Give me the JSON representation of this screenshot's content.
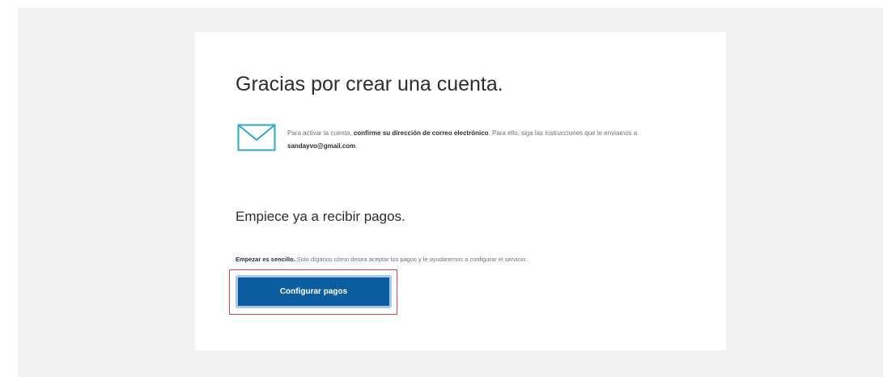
{
  "page": {
    "heading": "Gracias por crear una cuenta.",
    "confirm": {
      "icon": "envelope-icon",
      "text_1": "Para activar la cuenta, ",
      "bold_1": "confirme su dirección de correo electrónico",
      "text_2": ". Para ello, siga las instrucciones que le enviamos a ",
      "email": "sandayvo@gmail.com",
      "text_3": "."
    },
    "subheading": "Empiece ya a recibir pagos.",
    "intro": {
      "bold": "Empezar es sencillo.",
      "text": " Solo díganos cómo desea aceptar los pagos y le ayudaremos a configurar el servicio."
    },
    "setup_button_label": "Configurar pagos"
  },
  "colors": {
    "page_background": "#ffffff",
    "backdrop": "#f2f2f2",
    "card": "#ffffff",
    "heading_text": "#2c2e2f",
    "body_text": "#6c7378",
    "icon": "#2ba8c9",
    "button": "#0c5d9e",
    "button_border": "#a8c9ea",
    "highlight": "#d94356"
  }
}
